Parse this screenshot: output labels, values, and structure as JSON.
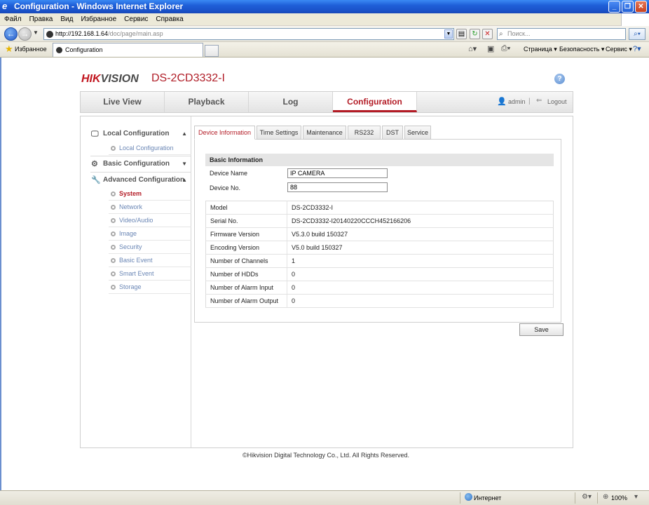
{
  "window": {
    "title": "Configuration - Windows Internet Explorer"
  },
  "menubar": {
    "items": [
      "Файл",
      "Правка",
      "Вид",
      "Избранное",
      "Сервис",
      "Справка"
    ]
  },
  "address": {
    "url_host": "http://192.168.1.64",
    "url_path": "/doc/page/main.asp",
    "search_placeholder": "Поиск..."
  },
  "favorites": {
    "label": "Избранное",
    "tab_title": "Configuration",
    "commands": [
      "Страница ▾",
      "Безопасность ▾",
      "Сервис ▾"
    ]
  },
  "header": {
    "brand_hik": "HIK",
    "brand_vision": "VISION",
    "model": "DS-2CD3332-I"
  },
  "topnav": {
    "tabs": [
      "Live View",
      "Playback",
      "Log",
      "Configuration"
    ],
    "active": "Configuration",
    "user": "admin",
    "separator": "|",
    "logout": "Logout"
  },
  "leftmenu": {
    "local": {
      "label": "Local Configuration",
      "items": [
        "Local Configuration"
      ]
    },
    "basic": {
      "label": "Basic Configuration"
    },
    "advanced": {
      "label": "Advanced Configuration",
      "items": [
        "System",
        "Network",
        "Video/Audio",
        "Image",
        "Security",
        "Basic Event",
        "Smart Event",
        "Storage"
      ],
      "active": "System"
    }
  },
  "subtabs": [
    "Device Information",
    "Time Settings",
    "Maintenance",
    "RS232",
    "DST",
    "Service"
  ],
  "basic_info": {
    "title": "Basic Information",
    "device_name_label": "Device Name",
    "device_name_value": "IP CAMERA",
    "device_no_label": "Device No.",
    "device_no_value": "88"
  },
  "info_table": [
    {
      "key": "Model",
      "value": "DS-2CD3332-I"
    },
    {
      "key": "Serial No.",
      "value": "DS-2CD3332-I20140220CCCH452166206"
    },
    {
      "key": "Firmware Version",
      "value": "V5.3.0 build 150327"
    },
    {
      "key": "Encoding Version",
      "value": "V5.0 build 150327"
    },
    {
      "key": "Number of Channels",
      "value": "1"
    },
    {
      "key": "Number of HDDs",
      "value": "0"
    },
    {
      "key": "Number of Alarm Input",
      "value": "0"
    },
    {
      "key": "Number of Alarm Output",
      "value": "0"
    }
  ],
  "save_label": "Save",
  "footer": "©Hikvision Digital Technology Co., Ltd. All Rights Reserved.",
  "statusbar": {
    "zone": "Интернет",
    "zoom": "100%"
  }
}
